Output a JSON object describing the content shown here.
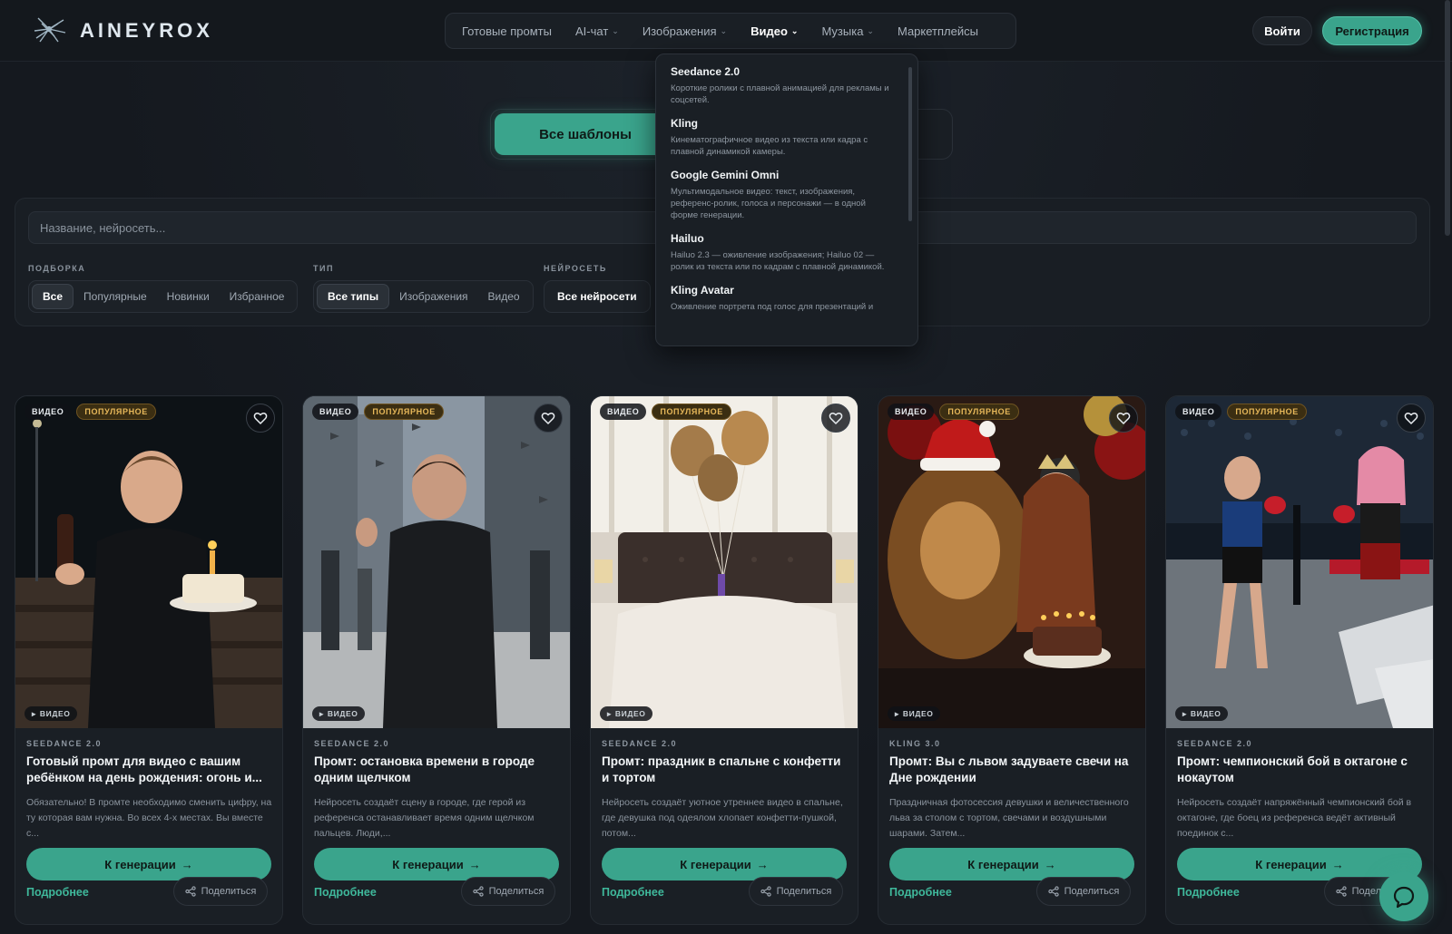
{
  "brand": {
    "name": "AINEYROX",
    "logo_icon": "bird-logo-icon"
  },
  "nav": {
    "items": [
      {
        "label": "Готовые промты",
        "has_dropdown": false,
        "active": false
      },
      {
        "label": "AI-чат",
        "has_dropdown": true,
        "active": false
      },
      {
        "label": "Изображения",
        "has_dropdown": true,
        "active": false
      },
      {
        "label": "Видео",
        "has_dropdown": true,
        "active": true
      },
      {
        "label": "Музыка",
        "has_dropdown": true,
        "active": false
      },
      {
        "label": "Маркетплейсы",
        "has_dropdown": false,
        "active": false
      }
    ]
  },
  "auth": {
    "login_label": "Войти",
    "register_label": "Регистрация"
  },
  "hero": {
    "all_templates_label": "Все шаблоны"
  },
  "filters": {
    "search_placeholder": "Название, нейросеть...",
    "collection": {
      "label": "ПОДБОРКА",
      "options": [
        "Все",
        "Популярные",
        "Новинки",
        "Избранное"
      ],
      "selected": "Все"
    },
    "type": {
      "label": "ТИП",
      "options": [
        "Все типы",
        "Изображения",
        "Видео"
      ],
      "selected": "Все типы"
    },
    "network": {
      "label": "НЕЙРОСЕТЬ",
      "selected": "Все нейросети"
    }
  },
  "video_dropdown": {
    "items": [
      {
        "title": "Seedance 2.0",
        "desc": "Короткие ролики с плавной анимацией для рекламы и соцсетей."
      },
      {
        "title": "Kling",
        "desc": "Кинематографичное видео из текста или кадра с плавной динамикой камеры."
      },
      {
        "title": "Google Gemini Omni",
        "desc": "Мультимодальное видео: текст, изображения, референс-ролик, голоса и персонажи — в одной форме генерации."
      },
      {
        "title": "Hailuo",
        "desc": "Hailuo 2.3 — оживление изображения; Hailuo 02 — ролик из текста или по кадрам с плавной динамикой."
      },
      {
        "title": "Kling Avatar",
        "desc": "Оживление портрета под голос для презентаций и"
      }
    ]
  },
  "cards_common": {
    "badge_video": "ВИДЕО",
    "badge_popular": "ПОПУЛЯРНОЕ",
    "video_chip": "ВИДЕО",
    "generate_label": "К генерации",
    "more_label": "Подробнее",
    "share_label": "Поделиться"
  },
  "cards": [
    {
      "model": "SEEDANCE 2.0",
      "title": "Готовый промт для видео с вашим ребёнком на день рождения: огонь и...",
      "desc": "Обязательно! В промте необходимо сменить цифру, на ту которая вам нужна. Во всех 4-х местах. Вы вместе с...",
      "scene": "boy-cake"
    },
    {
      "model": "SEEDANCE 2.0",
      "title": "Промт: остановка времени в городе одним щелчком",
      "desc": "Нейросеть создаёт сцену в городе, где герой из референса останавливает время одним щелчком пальцев. Люди,...",
      "scene": "city"
    },
    {
      "model": "SEEDANCE 2.0",
      "title": "Промт: праздник в спальне с конфетти и тортом",
      "desc": "Нейросеть создаёт уютное утреннее видео в спальне, где девушка под одеялом хлопает конфетти-пушкой, потом...",
      "scene": "bedroom"
    },
    {
      "model": "KLING 3.0",
      "title": "Промт: Вы с львом задуваете свечи на Дне рождении",
      "desc": "Праздничная фотосессия девушки и величественного льва за столом с тортом, свечами и воздушными шарами. Затем...",
      "scene": "lion"
    },
    {
      "model": "SEEDANCE 2.0",
      "title": "Промт: чемпионский бой в октагоне с нокаутом",
      "desc": "Нейросеть создаёт напряжённый чемпионский бой в октагоне, где боец из референса ведёт активный поединок с...",
      "scene": "fight"
    }
  ],
  "chat": {
    "icon": "chat-bubble-icon"
  }
}
